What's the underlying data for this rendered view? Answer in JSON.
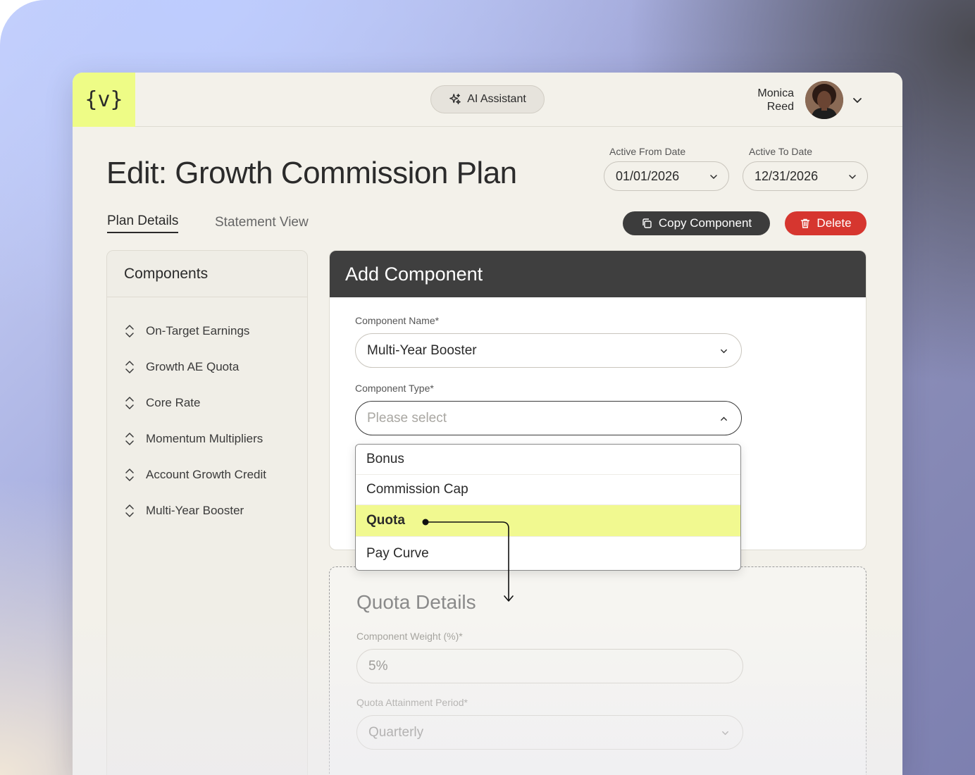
{
  "brand": {
    "logo_text": "{v}",
    "accent": "#eefc86"
  },
  "topbar": {
    "ai_assistant_label": "AI Assistant",
    "user_first": "Monica",
    "user_last": "Reed"
  },
  "page": {
    "title": "Edit: Growth Commission Plan",
    "active_from_label": "Active From Date",
    "active_from_value": "01/01/2026",
    "active_to_label": "Active To Date",
    "active_to_value": "12/31/2026"
  },
  "tabs": [
    {
      "label": "Plan Details",
      "active": true
    },
    {
      "label": "Statement View",
      "active": false
    }
  ],
  "actions": {
    "copy_label": "Copy Component",
    "delete_label": "Delete",
    "delete_color": "#d6362f"
  },
  "sidebar": {
    "title": "Components",
    "items": [
      {
        "label": "On-Target Earnings"
      },
      {
        "label": "Growth AE Quota"
      },
      {
        "label": "Core Rate"
      },
      {
        "label": "Momentum Multipliers"
      },
      {
        "label": "Account Growth Credit"
      },
      {
        "label": "Multi-Year Booster"
      }
    ]
  },
  "add_component": {
    "title": "Add Component",
    "name_label": "Component Name*",
    "name_value": "Multi-Year Booster",
    "type_label": "Component Type*",
    "type_placeholder": "Please select",
    "type_options": [
      {
        "label": "Bonus"
      },
      {
        "label": "Commission Cap"
      },
      {
        "label": "Quota"
      },
      {
        "label": "Pay Curve"
      }
    ],
    "highlighted_option": "Quota"
  },
  "quota_details": {
    "title": "Quota Details",
    "weight_label": "Component Weight (%)*",
    "weight_value": "5%",
    "period_label": "Quota Attainment Period*",
    "period_value": "Quarterly"
  }
}
